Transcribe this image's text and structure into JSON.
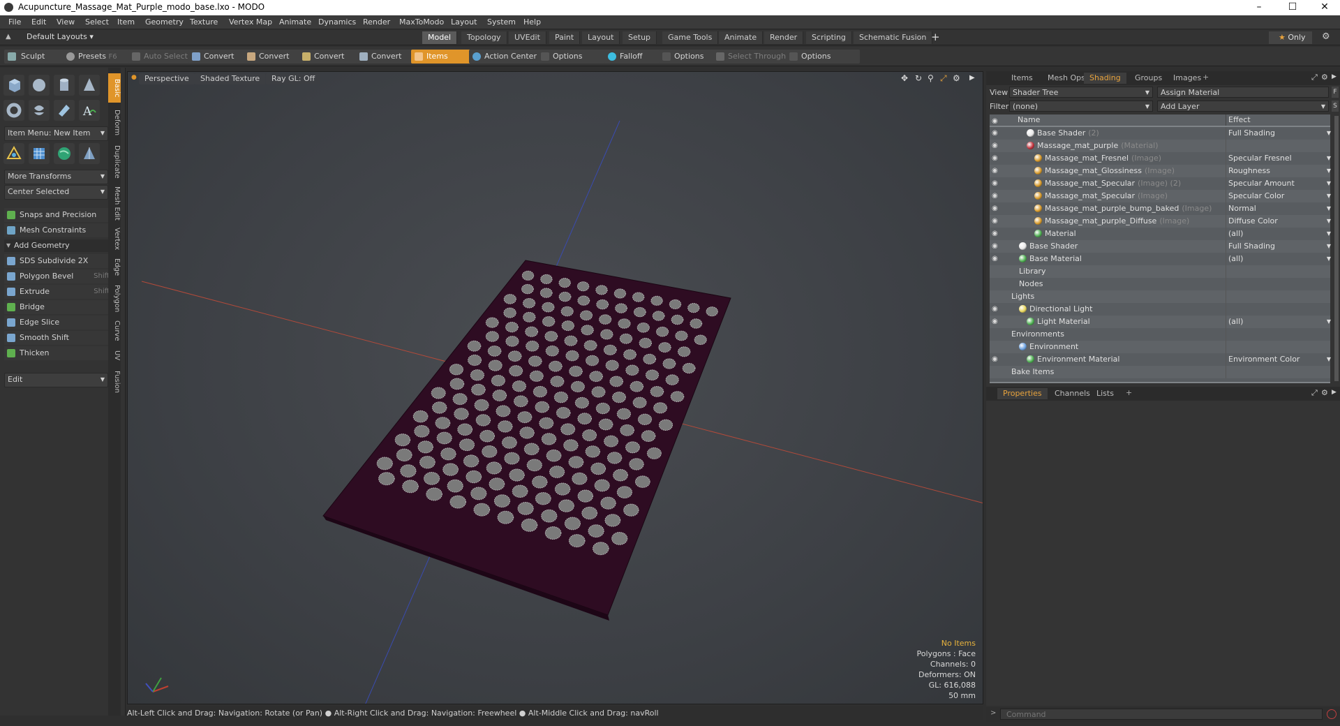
{
  "window": {
    "title": "Acupuncture_Massage_Mat_Purple_modo_base.lxo - MODO"
  },
  "menubar": [
    "File",
    "Edit",
    "View",
    "Select",
    "Item",
    "Geometry",
    "Texture",
    "Vertex Map",
    "Animate",
    "Dynamics",
    "Render",
    "MaxToModo",
    "Layout",
    "System",
    "Help"
  ],
  "layout": {
    "default_layouts": "Default Layouts",
    "tabs": [
      "Model",
      "Topology",
      "UVEdit",
      "Paint",
      "Layout",
      "Setup",
      "Game Tools",
      "Animate",
      "Render",
      "Scripting",
      "Schematic Fusion"
    ],
    "active_tab": "Model",
    "only_label": "Only"
  },
  "toolbar": {
    "sculpt": "Sculpt",
    "presets": "Presets",
    "presets_key": "F6",
    "auto_select": "Auto Select",
    "convert1": "Convert",
    "convert2": "Convert",
    "convert3": "Convert",
    "convert4": "Convert",
    "items": "Items",
    "action_center": "Action Center",
    "options1": "Options",
    "falloff": "Falloff",
    "options2": "Options",
    "select_through": "Select Through",
    "options3": "Options"
  },
  "leftpanel": {
    "item_menu": "Item Menu: New Item",
    "more_transforms": "More Transforms",
    "center_selected": "Center Selected",
    "snaps": "Snaps and Precision",
    "mesh_constraints": "Mesh Constraints",
    "add_geometry": "Add Geometry",
    "tools": [
      {
        "label": "SDS Subdivide 2X",
        "shortcut": ""
      },
      {
        "label": "Polygon Bevel",
        "shortcut": "Shift-B"
      },
      {
        "label": "Extrude",
        "shortcut": "Shift-X"
      },
      {
        "label": "Bridge",
        "shortcut": ""
      },
      {
        "label": "Edge Slice",
        "shortcut": ""
      },
      {
        "label": "Smooth Shift",
        "shortcut": ""
      },
      {
        "label": "Thicken",
        "shortcut": ""
      }
    ],
    "edit": "Edit",
    "vtabs": [
      "Basic",
      "Deform",
      "Duplicate",
      "Mesh Edit",
      "Vertex",
      "Edge",
      "Polygon",
      "Curve",
      "UV",
      "Fusion"
    ]
  },
  "viewport": {
    "perspective": "Perspective",
    "shading": "Shaded Texture",
    "raygl": "Ray GL: Off",
    "info": {
      "no_items": "No Items",
      "polygons": "Polygons : Face",
      "channels": "Channels: 0",
      "deformers": "Deformers: ON",
      "gl": "GL: 616,088",
      "size": "50 mm"
    }
  },
  "status": "Alt-Left Click and Drag: Navigation: Rotate (or Pan) ●  Alt-Right Click and Drag: Navigation: Freewheel ●  Alt-Middle Click and Drag: navRoll",
  "command_placeholder": "Command",
  "shading": {
    "tabs": [
      "Items",
      "Mesh Ops",
      "Shading",
      "Groups",
      "Images"
    ],
    "active_tab": "Shading",
    "view_label": "View",
    "view_value": "Shader Tree",
    "assign_material": "Assign Material",
    "filter_label": "Filter",
    "filter_value": "(none)",
    "add_layer": "Add Layer",
    "col_name": "Name",
    "col_effect": "Effect",
    "rows": [
      {
        "name": "Base Shader",
        "suffix": "(2)",
        "effect": "Full Shading",
        "indent": 3,
        "eye": true,
        "ball": "#e8e8e8"
      },
      {
        "name": "Massage_mat_purple",
        "suffix": "(Material)",
        "effect": "",
        "indent": 3,
        "eye": true,
        "ball": "#c0303a"
      },
      {
        "name": "Massage_mat_Fresnel",
        "suffix": "(Image)",
        "effect": "Specular Fresnel",
        "indent": 4,
        "eye": true,
        "ball": "#d89a2a"
      },
      {
        "name": "Massage_mat_Glossiness",
        "suffix": "(Image)",
        "effect": "Roughness",
        "indent": 4,
        "eye": true,
        "ball": "#d89a2a"
      },
      {
        "name": "Massage_mat_Specular",
        "suffix": "(Image) (2)",
        "effect": "Specular Amount",
        "indent": 4,
        "eye": true,
        "ball": "#d89a2a"
      },
      {
        "name": "Massage_mat_Specular",
        "suffix": "(Image)",
        "effect": "Specular Color",
        "indent": 4,
        "eye": true,
        "ball": "#d89a2a"
      },
      {
        "name": "Massage_mat_purple_bump_baked",
        "suffix": "(Image)",
        "effect": "Normal",
        "indent": 4,
        "eye": true,
        "ball": "#d89a2a"
      },
      {
        "name": "Massage_mat_purple_Diffuse",
        "suffix": "(Image)",
        "effect": "Diffuse Color",
        "indent": 4,
        "eye": true,
        "ball": "#d89a2a"
      },
      {
        "name": "Material",
        "suffix": "",
        "effect": "(all)",
        "indent": 4,
        "eye": true,
        "ball": "#4caf50"
      },
      {
        "name": "Base Shader",
        "suffix": "",
        "effect": "Full Shading",
        "indent": 2,
        "eye": true,
        "ball": "#e8e8e8"
      },
      {
        "name": "Base Material",
        "suffix": "",
        "effect": "(all)",
        "indent": 2,
        "eye": true,
        "ball": "#4caf50"
      },
      {
        "name": "Library",
        "suffix": "",
        "effect": "",
        "indent": 2,
        "eye": false,
        "ball": ""
      },
      {
        "name": "Nodes",
        "suffix": "",
        "effect": "",
        "indent": 2,
        "eye": false,
        "ball": ""
      },
      {
        "name": "Lights",
        "suffix": "",
        "effect": "",
        "indent": 1,
        "eye": false,
        "ball": ""
      },
      {
        "name": "Directional Light",
        "suffix": "",
        "effect": "",
        "indent": 2,
        "eye": true,
        "ball": "#e6d45a"
      },
      {
        "name": "Light Material",
        "suffix": "",
        "effect": "(all)",
        "indent": 3,
        "eye": true,
        "ball": "#4caf50"
      },
      {
        "name": "Environments",
        "suffix": "",
        "effect": "",
        "indent": 1,
        "eye": false,
        "ball": ""
      },
      {
        "name": "Environment",
        "suffix": "",
        "effect": "",
        "indent": 2,
        "eye": false,
        "ball": "#6aa0e0"
      },
      {
        "name": "Environment Material",
        "suffix": "",
        "effect": "Environment Color",
        "indent": 3,
        "eye": true,
        "ball": "#4caf50"
      },
      {
        "name": "Bake Items",
        "suffix": "",
        "effect": "",
        "indent": 1,
        "eye": false,
        "ball": ""
      }
    ]
  },
  "properties": {
    "tabs": [
      "Properties",
      "Channels",
      "Lists"
    ],
    "active_tab": "Properties"
  },
  "colors": {
    "accent": "#e0952a",
    "mat": "#2e0c22"
  }
}
